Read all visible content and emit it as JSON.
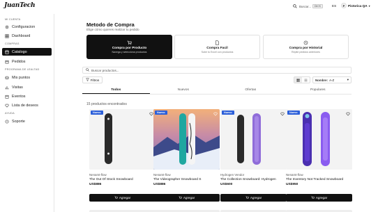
{
  "brand": {
    "logo_text": "JuanTech"
  },
  "topbar": {
    "search_placeholder": "Buscar...",
    "search_shortcut": "Ctrl K",
    "language": "ES",
    "user_initial": "P",
    "user_name": "Pictorica QA"
  },
  "sidebar": {
    "sections": [
      {
        "title": "MI CUENTA"
      },
      {
        "title": "COMPRAS"
      },
      {
        "title": "PROGRAMA DE LEALTAD"
      },
      {
        "title": "AYUDA"
      }
    ],
    "items": [
      {
        "label": "Configuracion",
        "icon": "gear-icon"
      },
      {
        "label": "Dashboard",
        "icon": "grid-icon"
      },
      {
        "label": "Catalogo",
        "icon": "store-icon",
        "active": true
      },
      {
        "label": "Pedidos",
        "icon": "box-icon"
      },
      {
        "label": "Mis puntos",
        "icon": "coins-icon"
      },
      {
        "label": "Visitas",
        "icon": "chart-icon"
      },
      {
        "label": "Eventos",
        "icon": "calendar-icon"
      },
      {
        "label": "Lista de deseos",
        "icon": "heart-icon"
      },
      {
        "label": "Soporte",
        "icon": "help-icon"
      }
    ]
  },
  "page": {
    "title": "Metodo de Compra",
    "subtitle": "Elige cómo quieres realizar tu pedido"
  },
  "methods": [
    {
      "title": "Compra por Producto",
      "desc": "Navega y selecciona productos",
      "icon": "cart-icon",
      "active": true
    },
    {
      "title": "Compra Facil",
      "desc": "Sube tu Excel con productos",
      "icon": "file-icon",
      "active": false
    },
    {
      "title": "Compra por Historial",
      "desc": "Repite pedidos anteriores",
      "icon": "history-icon",
      "active": false
    }
  ],
  "catalog": {
    "search_placeholder": "Buscar productos...",
    "filters_label": "Filtros",
    "sort_label": "Nombre:",
    "sort_value": "A-Z",
    "tabs": [
      "Todos",
      "Nuevos",
      "Ofertas",
      "Populares"
    ],
    "active_tab": 0,
    "count_text": "15 productos encontrados",
    "add_label": "Agregar"
  },
  "products": [
    {
      "badge": "Nuevo",
      "vendor": "Nenamt-flow",
      "name": "The Out Of Stock Snowboard",
      "price": "US$886",
      "colors": {
        "board": "#2a2a2a",
        "accent": "#e6e6e6"
      }
    },
    {
      "badge": "Nuevo",
      "vendor": "Nenamt-flow",
      "name": "The Videographer Snowboard S",
      "price": "US$886",
      "colors": {
        "board": "#1fa7a0",
        "accent": "#ffffff"
      }
    },
    {
      "badge": "Nuevo",
      "vendor": "Hydrogen Vendor",
      "name": "The Collection Snowboard: Hydrogen",
      "price": "US$600",
      "colors": {
        "board": "#2a2a2a",
        "accent": "#8f6cd9"
      }
    },
    {
      "badge": "Nuevo",
      "vendor": "Nenamt-flow",
      "name": "The Inventory Not Tracked Snowboard",
      "price": "US$950",
      "colors": {
        "board": "#4a2fb0",
        "accent": "#8a5cf0"
      }
    }
  ],
  "colors": {
    "accent": "#111111",
    "badge": "#2b5fd9"
  }
}
